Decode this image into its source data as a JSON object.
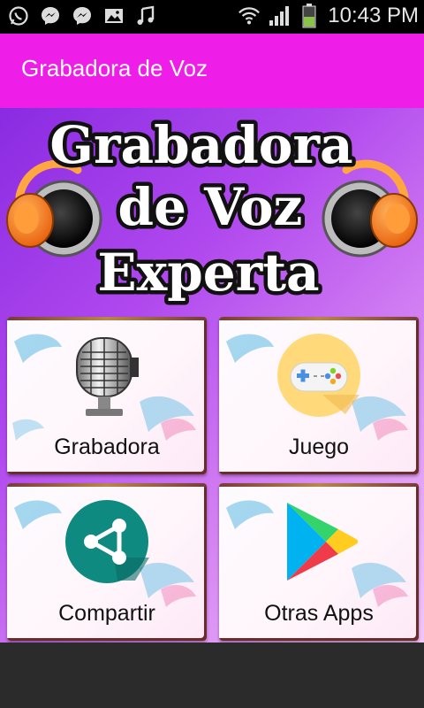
{
  "status_bar": {
    "time": "10:43 PM",
    "left_icons": [
      "whatsapp-icon",
      "messenger-icon",
      "messenger-icon",
      "gallery-icon",
      "music-icon"
    ],
    "right_icons": [
      "wifi-icon",
      "signal-icon",
      "battery-icon"
    ]
  },
  "app_bar": {
    "title": "Grabadora de Voz",
    "color": "#EE1EE8"
  },
  "banner": {
    "line1": "Grabadora",
    "line2": "de Voz",
    "line3": "Experta"
  },
  "cards": [
    {
      "label": "Grabadora",
      "icon": "microphone-icon"
    },
    {
      "label": "Juego",
      "icon": "gamepad-icon"
    },
    {
      "label": "Compartir",
      "icon": "share-icon"
    },
    {
      "label": "Otras Apps",
      "icon": "play-store-icon"
    }
  ]
}
